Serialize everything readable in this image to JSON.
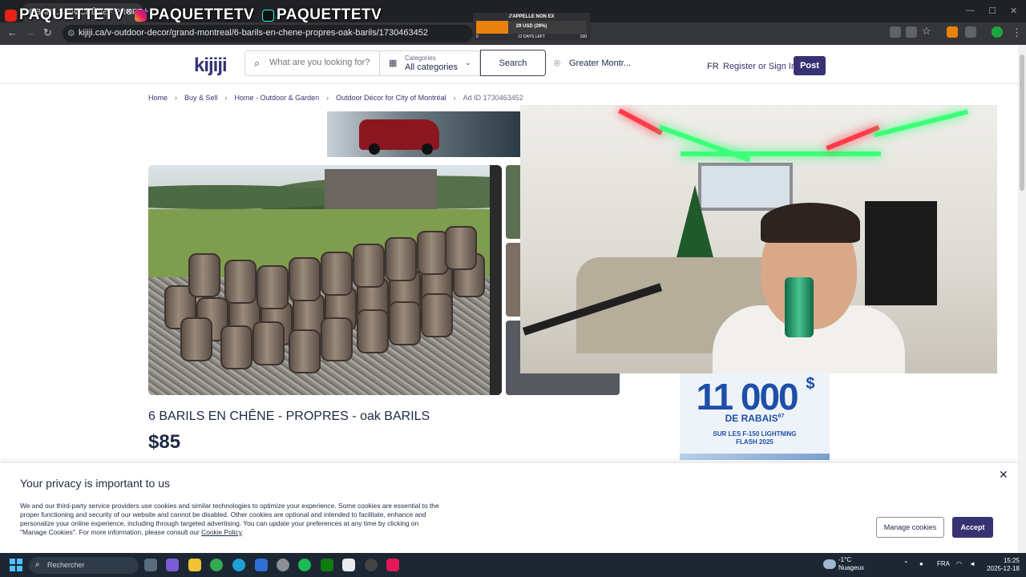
{
  "browser": {
    "tab_title": "6 BARILS EN CHÊNE - PROPR...",
    "url": "kijiji.ca/v-outdoor-decor/grand-montreal/6-barils-en-chene-propres-oak-barils/1730463452"
  },
  "stream_overlay": {
    "brands": [
      "PAQUETTETV",
      "PAQUETTETV",
      "PAQUETTETV"
    ],
    "sub_goal": {
      "title": "J'APPELLE NON EX",
      "progress_text": "29 USD (29%)",
      "progress_fraction": 0.29,
      "min": "0",
      "days_left": "12 DAYS LEFT",
      "max": "100"
    }
  },
  "header": {
    "logo": "kijiji",
    "search_placeholder": "What are you looking for?",
    "categories_label": "Categories",
    "categories_value": "All categories",
    "search_button": "Search",
    "location": "Greater Montr...",
    "lang": "FR",
    "register_label": "Register or Sign In",
    "post_button": "Post"
  },
  "breadcrumbs": {
    "items": [
      "Home",
      "Buy & Sell",
      "Home - Outdoor & Garden",
      "Outdoor Décor for City of Montréal"
    ],
    "ad_id": "Ad ID 1730463452"
  },
  "listing": {
    "title": "6 BARILS EN CHÊNE - PROPRES - oak BARILS",
    "price": "$85"
  },
  "side_ad": {
    "amount": "11 000",
    "currency": "$",
    "rabais": "DE RABAIS",
    "rabais_sup": "67",
    "line1": "SUR LES F-150 LIGHTNING",
    "line2": "FLASH 2025"
  },
  "privacy": {
    "title": "Your privacy is important to us",
    "body": "We and our third-party service providers use cookies and similar technologies to optimize your experience. Some cookies are essential to the proper functioning and security of our website and cannot be disabled. Other cookies are optional and intended to facilitate, enhance and personalize your online experience, including through targeted advertising. You can update your preferences at any time by clicking on \"Manage Cookies\". For more information, please consult our ",
    "link": "Cookie Policy",
    "manage_button": "Manage cookies",
    "accept_button": "Accept"
  },
  "taskbar": {
    "search_placeholder": "Rechercher",
    "weather_temp": "-1°C",
    "weather_desc": "Nuageux",
    "lang": "FRA",
    "time": "15:25",
    "date": "2025-12-18"
  },
  "colors": {
    "brand": "#373373",
    "accent_orange": "#e8820c"
  }
}
